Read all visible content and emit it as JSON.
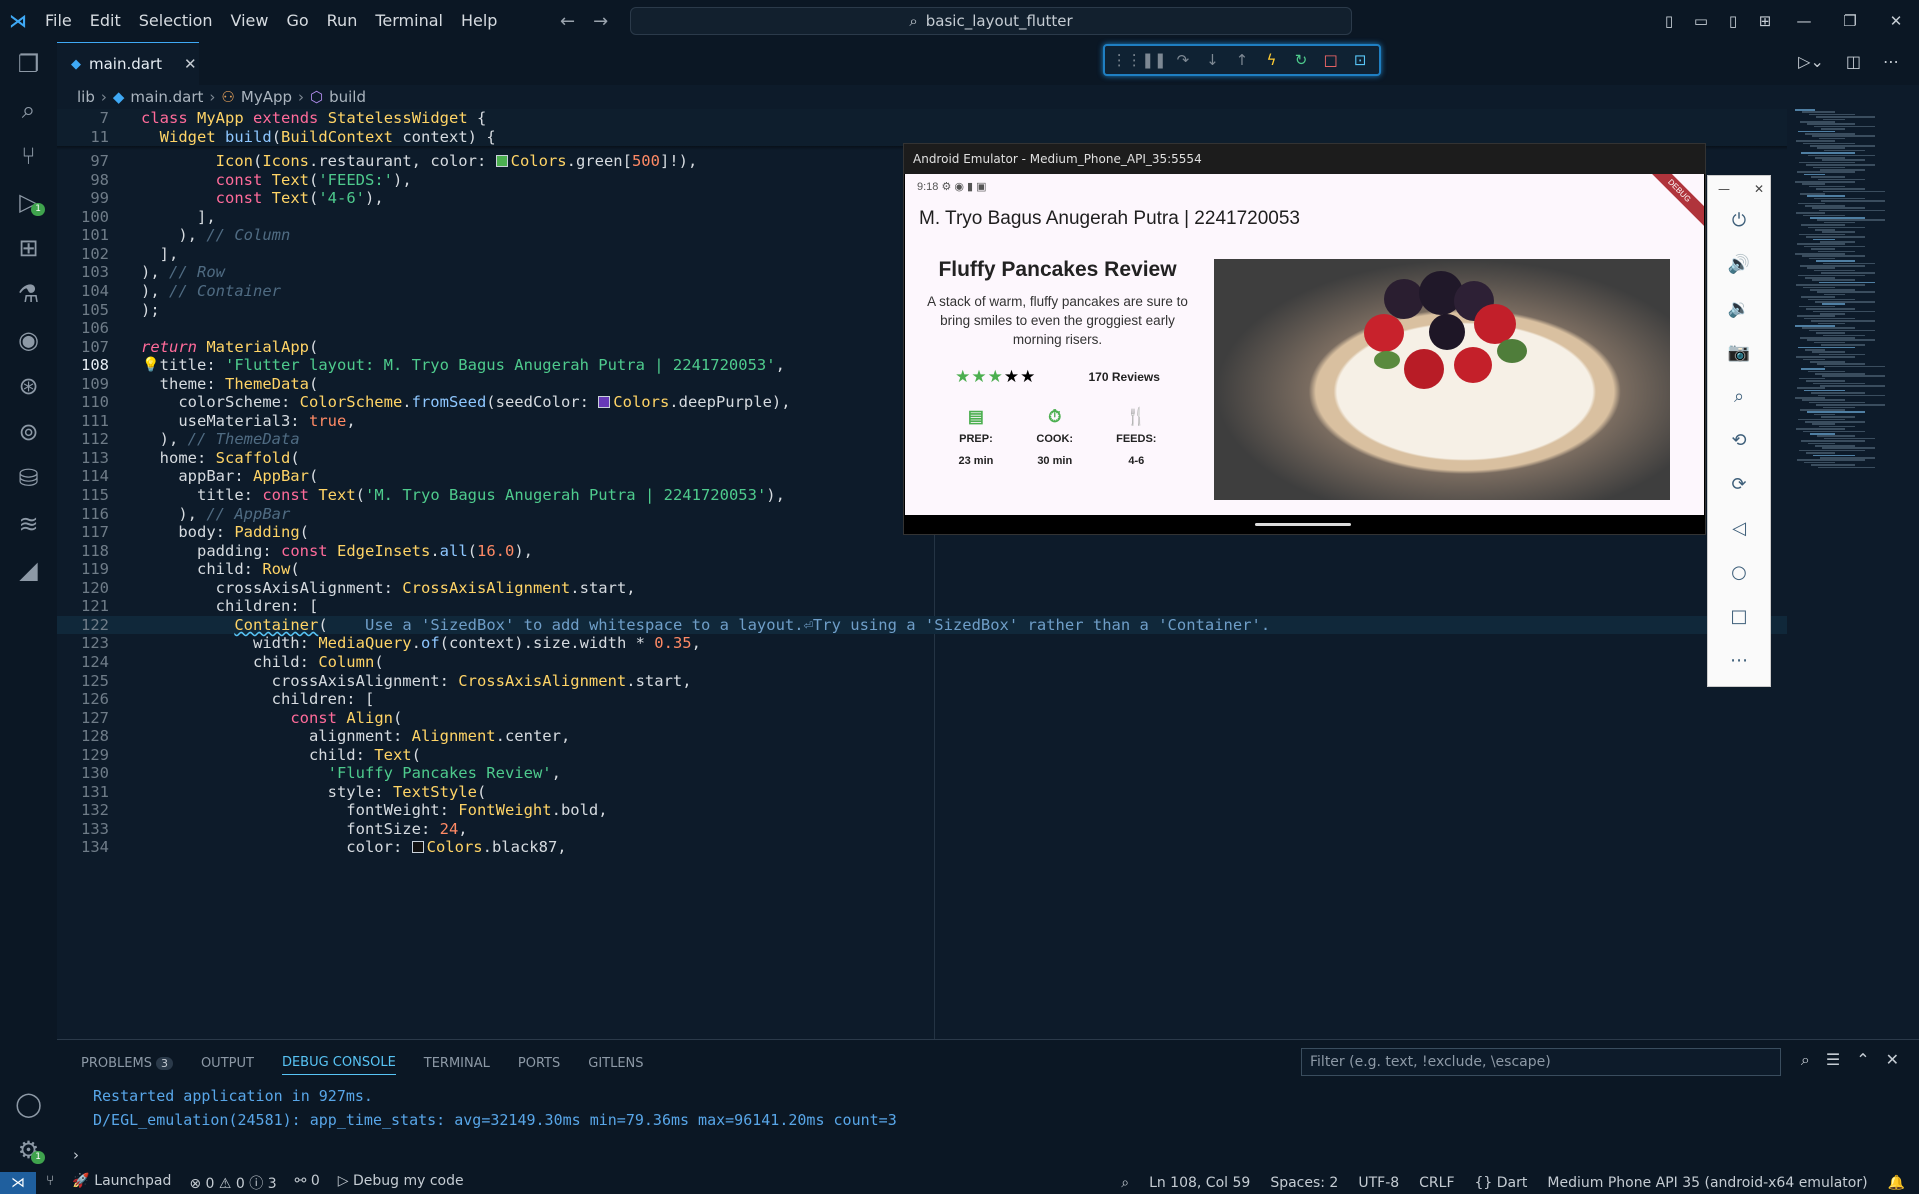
{
  "menus": [
    "File",
    "Edit",
    "Selection",
    "View",
    "Go",
    "Run",
    "Terminal",
    "Help"
  ],
  "command_center": "basic_layout_flutter",
  "tab": {
    "name": "main.dart"
  },
  "breadcrumb": [
    "lib",
    "main.dart",
    "MyApp",
    "build"
  ],
  "sticky_lines": [
    {
      "num": "7",
      "html": "<span class='k'>class</span> <span class='t'>MyApp</span> <span class='k'>extends</span> <span class='t'>StatelessWidget</span> {"
    },
    {
      "num": "11",
      "html": "  <span class='t'>Widget</span> <span class='f'>build</span>(<span class='t'>BuildContext</span> context) {"
    }
  ],
  "code_lines": [
    {
      "num": "97",
      "html": "        <span class='t'>Icon</span>(<span class='t'>Icons</span>.restaurant, color: <span class='swatch' style='background:#4caf50'></span><span class='t'>Colors</span>.green[<span class='n'>500</span>]!),"
    },
    {
      "num": "98",
      "html": "        <span class='k'>const</span> <span class='t'>Text</span>(<span class='s'>'FEEDS:'</span>),"
    },
    {
      "num": "99",
      "html": "        <span class='k'>const</span> <span class='t'>Text</span>(<span class='s'>'4-6'</span>),"
    },
    {
      "num": "100",
      "html": "      ],"
    },
    {
      "num": "101",
      "html": "    ), <span class='c'>// Column</span>"
    },
    {
      "num": "102",
      "html": "  ],"
    },
    {
      "num": "103",
      "html": "), <span class='c'>// Row</span>"
    },
    {
      "num": "104",
      "html": "), <span class='c'>// Container</span>"
    },
    {
      "num": "105",
      "html": ");"
    },
    {
      "num": "106",
      "html": ""
    },
    {
      "num": "107",
      "html": "<span class='k' style='font-style:italic'>return</span> <span class='t'>MaterialApp</span>("
    },
    {
      "num": "108",
      "html": "  title: <span class='s'>'Flutter layout: M. Tryo Bagus Anugerah Putra | 2241720053'</span>,"
    },
    {
      "num": "109",
      "html": "  theme: <span class='t'>ThemeData</span>("
    },
    {
      "num": "110",
      "html": "    colorScheme: <span class='t'>ColorScheme</span>.<span class='f'>fromSeed</span>(seedColor: <span class='swatch' style='background:#673ab7'></span><span class='t'>Colors</span>.deepPurple),"
    },
    {
      "num": "111",
      "html": "    useMaterial3: <span class='n'>true</span>,"
    },
    {
      "num": "112",
      "html": "  ), <span class='c'>// ThemeData</span>"
    },
    {
      "num": "113",
      "html": "  home: <span class='t'>Scaffold</span>("
    },
    {
      "num": "114",
      "html": "    appBar: <span class='t'>AppBar</span>("
    },
    {
      "num": "115",
      "html": "      title: <span class='k'>const</span> <span class='t'>Text</span>(<span class='s'>'M. Tryo Bagus Anugerah Putra | 2241720053'</span>),"
    },
    {
      "num": "116",
      "html": "    ), <span class='c'>// AppBar</span>"
    },
    {
      "num": "117",
      "html": "    body: <span class='t'>Padding</span>("
    },
    {
      "num": "118",
      "html": "      padding: <span class='k'>const</span> <span class='t'>EdgeInsets</span>.<span class='f'>all</span>(<span class='n'>16.0</span>),"
    },
    {
      "num": "119",
      "html": "      child: <span class='t'>Row</span>("
    },
    {
      "num": "120",
      "html": "        crossAxisAlignment: <span class='t'>CrossAxisAlignment</span>.start,"
    },
    {
      "num": "121",
      "html": "        children: ["
    },
    {
      "num": "122",
      "html": "          <span class='t' style='text-decoration:underline wavy #58c4f5'>Container</span>(    <span class='hint'>Use a 'SizedBox' to add whitespace to a layout.⏎Try using a 'SizedBox' rather than a 'Container'.</span>"
    },
    {
      "num": "123",
      "html": "            width: <span class='t'>MediaQuery</span>.<span class='f'>of</span>(context).size.width * <span class='n'>0.35</span>,"
    },
    {
      "num": "124",
      "html": "            child: <span class='t'>Column</span>("
    },
    {
      "num": "125",
      "html": "              crossAxisAlignment: <span class='t'>CrossAxisAlignment</span>.start,"
    },
    {
      "num": "126",
      "html": "              children: ["
    },
    {
      "num": "127",
      "html": "                <span class='k'>const</span> <span class='t'>Align</span>("
    },
    {
      "num": "128",
      "html": "                  alignment: <span class='t'>Alignment</span>.center,"
    },
    {
      "num": "129",
      "html": "                  child: <span class='t'>Text</span>("
    },
    {
      "num": "130",
      "html": "                    <span class='s'>'Fluffy Pancakes Review'</span>,"
    },
    {
      "num": "131",
      "html": "                    style: <span class='t'>TextStyle</span>("
    },
    {
      "num": "132",
      "html": "                      fontWeight: <span class='t'>FontWeight</span>.bold,"
    },
    {
      "num": "133",
      "html": "                      fontSize: <span class='n'>24</span>,"
    },
    {
      "num": "134",
      "html": "                      color: <span class='swatch' style='background:#111'></span><span class='t'>Colors</span>.black87,"
    }
  ],
  "emulator": {
    "title": "Android Emulator - Medium_Phone_API_35:5554",
    "time": "9:18",
    "debug_ribbon": "DEBUG",
    "appbar_title": "M. Tryo Bagus Anugerah Putra | 2241720053",
    "card_title": "Fluffy Pancakes Review",
    "card_desc": "A stack of warm, fluffy pancakes are sure to bring smiles to even the groggiest early morning risers.",
    "stars_green": 3,
    "stars_total": 5,
    "reviews": "170 Reviews",
    "prep_label": "PREP:",
    "prep_value": "23 min",
    "cook_label": "COOK:",
    "cook_value": "30 min",
    "feeds_label": "FEEDS:",
    "feeds_value": "4-6"
  },
  "panel": {
    "tabs": [
      "PROBLEMS",
      "OUTPUT",
      "DEBUG CONSOLE",
      "TERMINAL",
      "PORTS",
      "GITLENS"
    ],
    "problems_count": "3",
    "filter_placeholder": "Filter (e.g. text, !exclude, \\escape)",
    "console_lines": [
      "Restarted application in 927ms.",
      "D/EGL_emulation(24581): app_time_stats: avg=32149.30ms min=79.36ms max=96141.20ms count=3"
    ]
  },
  "status": {
    "launchpad": "Launchpad",
    "problems": "⊗ 0 ⚠ 0 ⓘ 3",
    "ports": "0",
    "debug": "Debug my code",
    "position": "Ln 108, Col 59",
    "spaces": "Spaces: 2",
    "encoding": "UTF-8",
    "eol": "CRLF",
    "language": "Dart",
    "device": "Medium Phone API 35 (android-x64 emulator)"
  },
  "colors": {
    "accent": "#3fa9f5",
    "green": "#4caf50",
    "debug_border": "#1f7fc2"
  }
}
